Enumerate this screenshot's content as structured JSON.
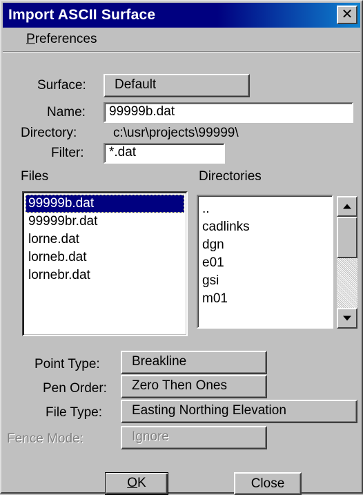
{
  "window": {
    "title": "Import ASCII Surface",
    "close_glyph": "✕",
    "close_icon": "close-icon"
  },
  "menu": {
    "preferences_mnemonic": "P",
    "preferences_rest": "references"
  },
  "surface": {
    "label": "Surface:",
    "value": "Default"
  },
  "name": {
    "label": "Name:",
    "value": "99999b.dat"
  },
  "directory": {
    "label": "Directory:",
    "value": "c:\\usr\\projects\\99999\\"
  },
  "filter": {
    "label": "Filter:",
    "value": "*.dat"
  },
  "files": {
    "label": "Files",
    "items": [
      "99999b.dat",
      "99999br.dat",
      "lorne.dat",
      "lorneb.dat",
      "lornebr.dat"
    ],
    "selected_index": 0
  },
  "directories": {
    "label": "Directories",
    "items": [
      "..",
      "cadlinks",
      "dgn",
      "e01",
      "gsi",
      "m01"
    ]
  },
  "point_type": {
    "label": "Point Type:",
    "value": "Breakline"
  },
  "pen_order": {
    "label": "Pen Order:",
    "value": "Zero Then Ones"
  },
  "file_type": {
    "label": "File Type:",
    "value": "Easting Northing Elevation"
  },
  "fence_mode": {
    "label": "Fence Mode:",
    "value": "Ignore",
    "disabled": true
  },
  "buttons": {
    "ok_mnemonic": "O",
    "ok_rest": "K",
    "close": "Close"
  },
  "colors": {
    "face": "#c0c0c0",
    "title_bar": "#000080",
    "selection": "#000080",
    "disabled_text": "#808080"
  }
}
